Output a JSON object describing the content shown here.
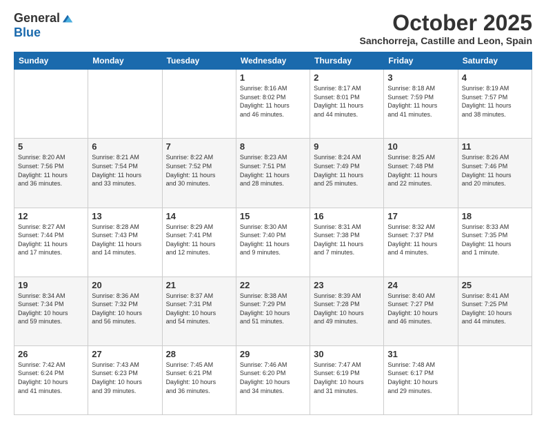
{
  "logo": {
    "general": "General",
    "blue": "Blue"
  },
  "title": "October 2025",
  "subtitle": "Sanchorreja, Castille and Leon, Spain",
  "headers": [
    "Sunday",
    "Monday",
    "Tuesday",
    "Wednesday",
    "Thursday",
    "Friday",
    "Saturday"
  ],
  "weeks": [
    [
      {
        "day": "",
        "info": ""
      },
      {
        "day": "",
        "info": ""
      },
      {
        "day": "",
        "info": ""
      },
      {
        "day": "1",
        "info": "Sunrise: 8:16 AM\nSunset: 8:02 PM\nDaylight: 11 hours\nand 46 minutes."
      },
      {
        "day": "2",
        "info": "Sunrise: 8:17 AM\nSunset: 8:01 PM\nDaylight: 11 hours\nand 44 minutes."
      },
      {
        "day": "3",
        "info": "Sunrise: 8:18 AM\nSunset: 7:59 PM\nDaylight: 11 hours\nand 41 minutes."
      },
      {
        "day": "4",
        "info": "Sunrise: 8:19 AM\nSunset: 7:57 PM\nDaylight: 11 hours\nand 38 minutes."
      }
    ],
    [
      {
        "day": "5",
        "info": "Sunrise: 8:20 AM\nSunset: 7:56 PM\nDaylight: 11 hours\nand 36 minutes."
      },
      {
        "day": "6",
        "info": "Sunrise: 8:21 AM\nSunset: 7:54 PM\nDaylight: 11 hours\nand 33 minutes."
      },
      {
        "day": "7",
        "info": "Sunrise: 8:22 AM\nSunset: 7:52 PM\nDaylight: 11 hours\nand 30 minutes."
      },
      {
        "day": "8",
        "info": "Sunrise: 8:23 AM\nSunset: 7:51 PM\nDaylight: 11 hours\nand 28 minutes."
      },
      {
        "day": "9",
        "info": "Sunrise: 8:24 AM\nSunset: 7:49 PM\nDaylight: 11 hours\nand 25 minutes."
      },
      {
        "day": "10",
        "info": "Sunrise: 8:25 AM\nSunset: 7:48 PM\nDaylight: 11 hours\nand 22 minutes."
      },
      {
        "day": "11",
        "info": "Sunrise: 8:26 AM\nSunset: 7:46 PM\nDaylight: 11 hours\nand 20 minutes."
      }
    ],
    [
      {
        "day": "12",
        "info": "Sunrise: 8:27 AM\nSunset: 7:44 PM\nDaylight: 11 hours\nand 17 minutes."
      },
      {
        "day": "13",
        "info": "Sunrise: 8:28 AM\nSunset: 7:43 PM\nDaylight: 11 hours\nand 14 minutes."
      },
      {
        "day": "14",
        "info": "Sunrise: 8:29 AM\nSunset: 7:41 PM\nDaylight: 11 hours\nand 12 minutes."
      },
      {
        "day": "15",
        "info": "Sunrise: 8:30 AM\nSunset: 7:40 PM\nDaylight: 11 hours\nand 9 minutes."
      },
      {
        "day": "16",
        "info": "Sunrise: 8:31 AM\nSunset: 7:38 PM\nDaylight: 11 hours\nand 7 minutes."
      },
      {
        "day": "17",
        "info": "Sunrise: 8:32 AM\nSunset: 7:37 PM\nDaylight: 11 hours\nand 4 minutes."
      },
      {
        "day": "18",
        "info": "Sunrise: 8:33 AM\nSunset: 7:35 PM\nDaylight: 11 hours\nand 1 minute."
      }
    ],
    [
      {
        "day": "19",
        "info": "Sunrise: 8:34 AM\nSunset: 7:34 PM\nDaylight: 10 hours\nand 59 minutes."
      },
      {
        "day": "20",
        "info": "Sunrise: 8:36 AM\nSunset: 7:32 PM\nDaylight: 10 hours\nand 56 minutes."
      },
      {
        "day": "21",
        "info": "Sunrise: 8:37 AM\nSunset: 7:31 PM\nDaylight: 10 hours\nand 54 minutes."
      },
      {
        "day": "22",
        "info": "Sunrise: 8:38 AM\nSunset: 7:29 PM\nDaylight: 10 hours\nand 51 minutes."
      },
      {
        "day": "23",
        "info": "Sunrise: 8:39 AM\nSunset: 7:28 PM\nDaylight: 10 hours\nand 49 minutes."
      },
      {
        "day": "24",
        "info": "Sunrise: 8:40 AM\nSunset: 7:27 PM\nDaylight: 10 hours\nand 46 minutes."
      },
      {
        "day": "25",
        "info": "Sunrise: 8:41 AM\nSunset: 7:25 PM\nDaylight: 10 hours\nand 44 minutes."
      }
    ],
    [
      {
        "day": "26",
        "info": "Sunrise: 7:42 AM\nSunset: 6:24 PM\nDaylight: 10 hours\nand 41 minutes."
      },
      {
        "day": "27",
        "info": "Sunrise: 7:43 AM\nSunset: 6:23 PM\nDaylight: 10 hours\nand 39 minutes."
      },
      {
        "day": "28",
        "info": "Sunrise: 7:45 AM\nSunset: 6:21 PM\nDaylight: 10 hours\nand 36 minutes."
      },
      {
        "day": "29",
        "info": "Sunrise: 7:46 AM\nSunset: 6:20 PM\nDaylight: 10 hours\nand 34 minutes."
      },
      {
        "day": "30",
        "info": "Sunrise: 7:47 AM\nSunset: 6:19 PM\nDaylight: 10 hours\nand 31 minutes."
      },
      {
        "day": "31",
        "info": "Sunrise: 7:48 AM\nSunset: 6:17 PM\nDaylight: 10 hours\nand 29 minutes."
      },
      {
        "day": "",
        "info": ""
      }
    ]
  ]
}
